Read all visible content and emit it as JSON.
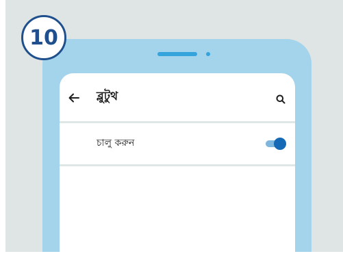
{
  "step": {
    "number": "10"
  },
  "app_bar": {
    "title": "ব্লুটুথ",
    "back_icon": "arrow-left-icon",
    "search_icon": "search-icon"
  },
  "setting": {
    "label": "চালু করুন",
    "toggle_state": "on"
  },
  "colors": {
    "background": "#dfe5e5",
    "phone_body": "#a3d4ec",
    "phone_accent": "#35a3dc",
    "badge_border": "#1f4f8c",
    "toggle_thumb": "#1569b5",
    "toggle_track": "#7fb6de"
  }
}
